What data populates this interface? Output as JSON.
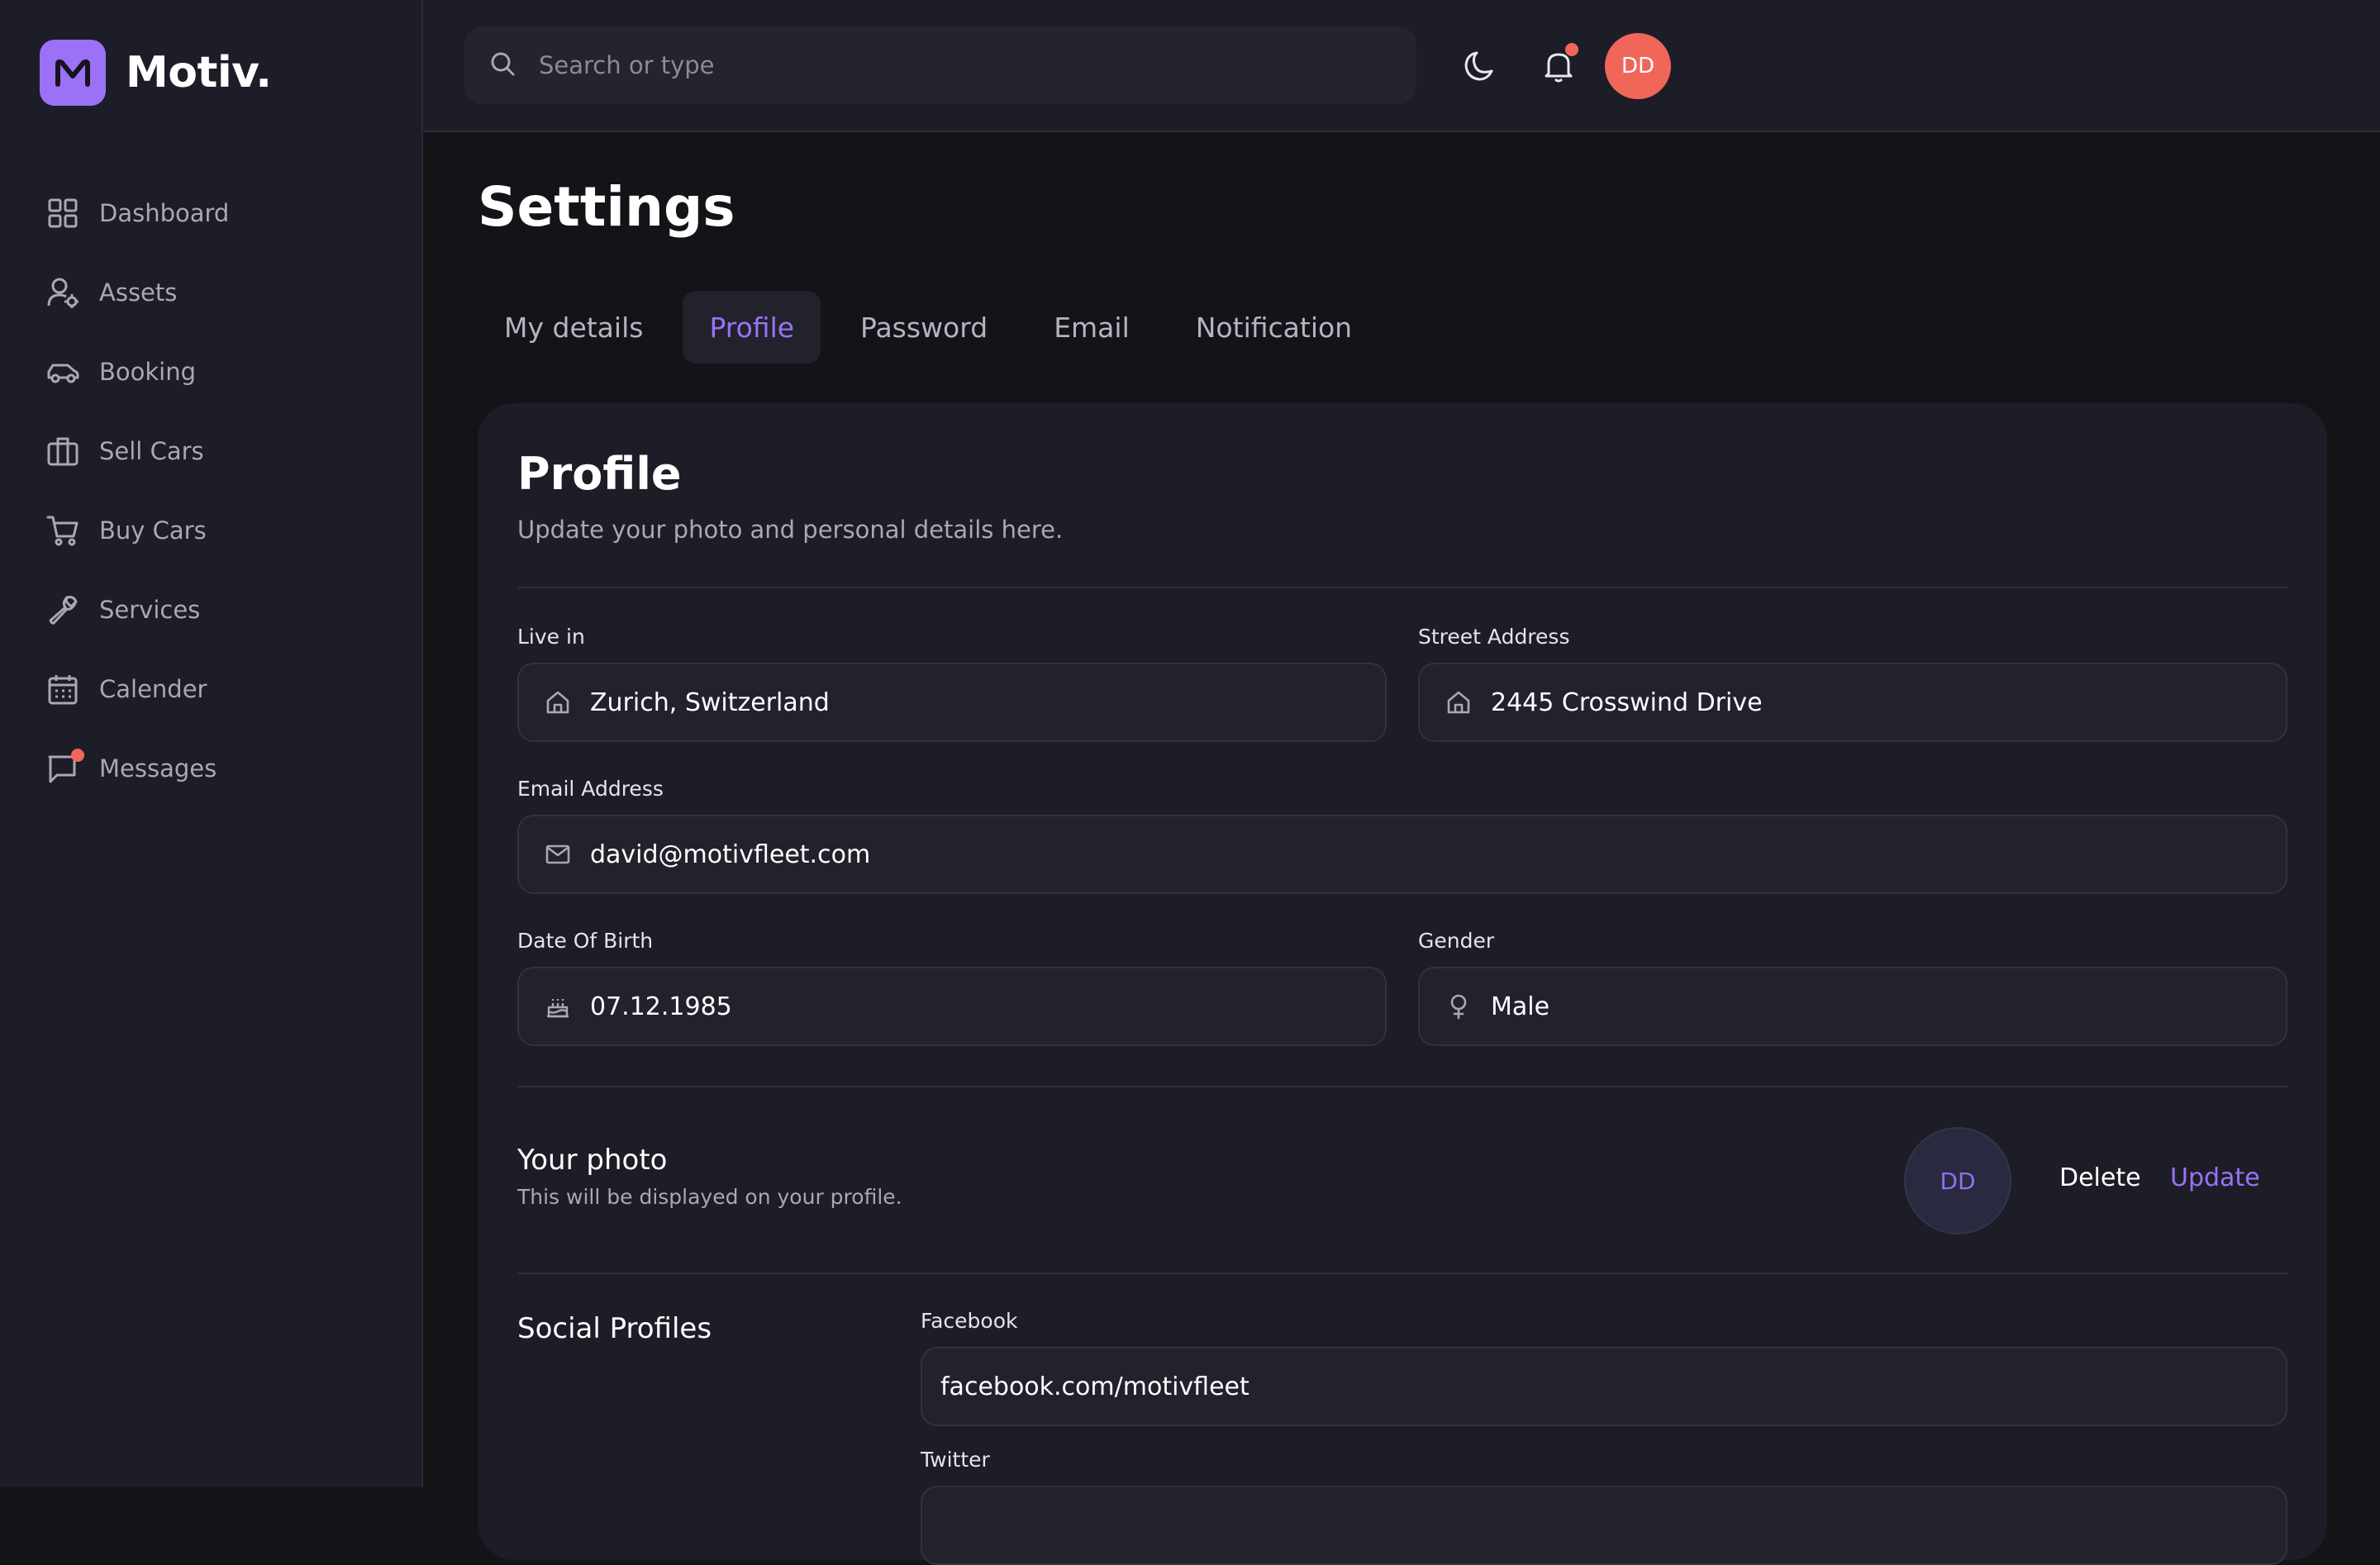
{
  "brand": {
    "name": "Motiv.",
    "logo_letter": "M",
    "accent": "#9b72f6"
  },
  "sidebar": {
    "items": [
      {
        "label": "Dashboard",
        "icon": "grid-icon"
      },
      {
        "label": "Assets",
        "icon": "user-gear-icon"
      },
      {
        "label": "Booking",
        "icon": "car-icon"
      },
      {
        "label": "Sell Cars",
        "icon": "briefcase-icon"
      },
      {
        "label": "Buy Cars",
        "icon": "cart-icon"
      },
      {
        "label": "Services",
        "icon": "wrench-icon"
      },
      {
        "label": "Calender",
        "icon": "calendar-icon"
      },
      {
        "label": "Messages",
        "icon": "message-icon",
        "has_notification": true
      }
    ]
  },
  "header": {
    "search_placeholder": "Search or type",
    "avatar_initials": "DD",
    "avatar_color": "#f0675a",
    "notification_dot_color": "#f0675a"
  },
  "page": {
    "title": "Settings",
    "tabs": [
      {
        "label": "My details",
        "active": false
      },
      {
        "label": "Profile",
        "active": true
      },
      {
        "label": "Password",
        "active": false
      },
      {
        "label": "Email",
        "active": false
      },
      {
        "label": "Notification",
        "active": false
      }
    ]
  },
  "profile": {
    "title": "Profile",
    "subtitle": "Update your photo and personal details here.",
    "fields": {
      "live_in": {
        "label": "Live in",
        "value": "Zurich, Switzerland",
        "icon": "home-icon"
      },
      "street": {
        "label": "Street Address",
        "value": "2445 Crosswind Drive",
        "icon": "home-icon"
      },
      "email": {
        "label": "Email Address",
        "value": "david@motivfleet.com",
        "icon": "mail-icon"
      },
      "dob": {
        "label": "Date Of Birth",
        "value": "07.12.1985",
        "icon": "cake-icon"
      },
      "gender": {
        "label": "Gender",
        "value": "Male",
        "icon": "gender-icon"
      }
    },
    "photo": {
      "title": "Your photo",
      "subtitle": "This will be displayed on your profile.",
      "initials": "DD",
      "delete_label": "Delete",
      "update_label": "Update"
    },
    "social": {
      "title": "Social Profiles",
      "facebook_label": "Facebook",
      "facebook_value": "facebook.com/motivfleet",
      "twitter_label": "Twitter"
    }
  }
}
